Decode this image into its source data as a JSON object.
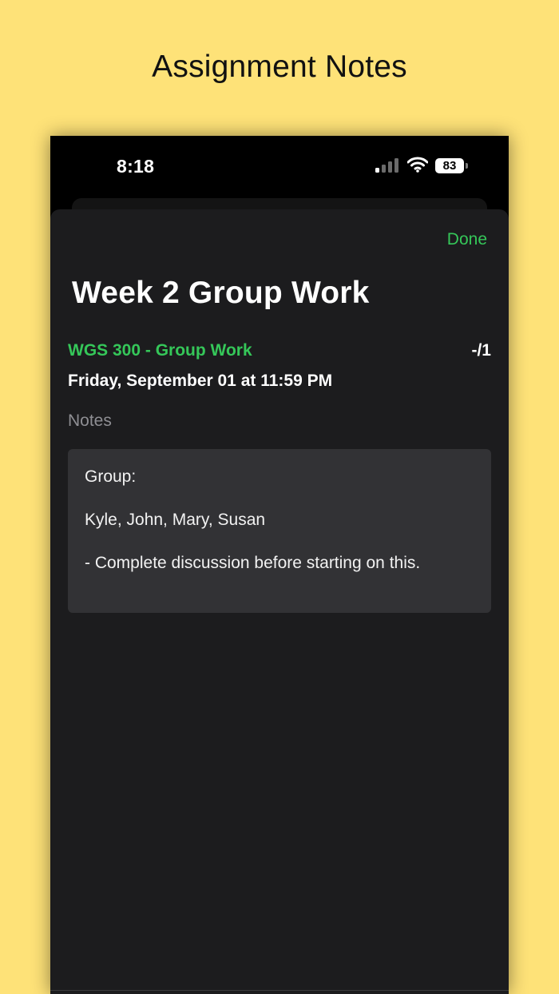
{
  "caption": "Assignment Notes",
  "status_bar": {
    "time": "8:18",
    "battery": "83",
    "icons": [
      "signal-icon",
      "wifi-icon",
      "battery-icon"
    ]
  },
  "header": {
    "done_label": "Done"
  },
  "assignment": {
    "title": "Week 2 Group Work",
    "course": "WGS 300 - Group Work",
    "score": "-/1",
    "due": "Friday, September 01 at 11:59 PM"
  },
  "notes": {
    "label": "Notes",
    "lines": [
      "Group:",
      "Kyle, John, Mary, Susan",
      "- Complete discussion before starting on this."
    ]
  },
  "colors": {
    "background": "#FEE278",
    "accent": "#35C759",
    "sheet": "#1C1C1E",
    "notes_box": "#323235"
  }
}
